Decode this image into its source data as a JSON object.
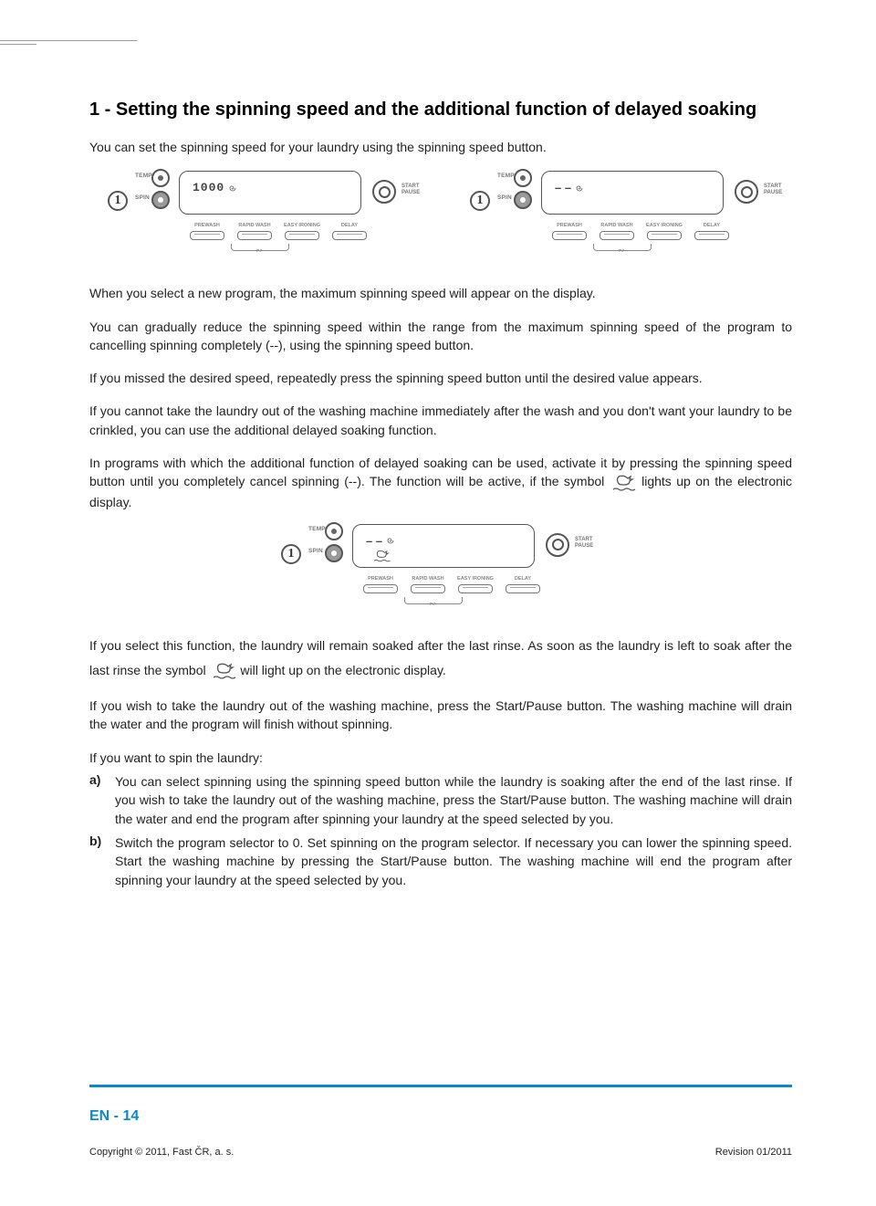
{
  "heading": "1 - Setting the spinning speed and the additional function of delayed soaking",
  "intro": "You can set the spinning speed for your laundry using the spinning speed button.",
  "p_select": "When you select a new program, the maximum spinning speed will appear on the display.",
  "p_reduce": "You can gradually reduce the spinning speed within the range from the maximum spinning speed of the program to cancelling spinning completely (--), using the spinning speed button.",
  "p_missed": "If you missed the desired speed, repeatedly press the spinning speed button until the desired value appears.",
  "p_crinkled": "If you cannot take the laundry out of the washing machine immediately after the wash and you don't want your laundry to be crinkled, you can use the additional delayed soaking function.",
  "p_activate_a": "In programs with which the additional function of delayed soaking can be used, activate it by pressing the spinning speed button until you completely cancel spinning (--). The function will be active, if the symbol ",
  "p_activate_b": " lights up on the electronic display.",
  "p_soaked_a": "If you select this function, the laundry will remain soaked after the last rinse. As soon as the laundry is left to soak after the last rinse the symbol ",
  "p_soaked_b": " will light up on the electronic display.",
  "p_drain": "If you wish to take the laundry out of the washing machine, press the Start/Pause button. The washing machine will drain the water and the program will finish without spinning.",
  "p_want_spin": "If you want to spin the laundry:",
  "list": {
    "a": {
      "marker": "a)",
      "text": "You can select spinning using the spinning speed button while the laundry is soaking after the end of the last rinse.  If you wish to take the laundry out of the washing machine, press the Start/Pause button. The washing machine will drain the water and end the program after spinning your laundry at the speed selected by you."
    },
    "b": {
      "marker": "b)",
      "text": "Switch the program selector to 0.  Set spinning on the program selector. If necessary you can lower the spinning speed. Start the washing machine by pressing the Start/Pause button. The washing machine will end the program after spinning your laundry at the speed selected by you."
    }
  },
  "panel": {
    "temp": "TEMP.",
    "spin": "SPIN",
    "start": "START",
    "pause": "PAUSE",
    "one": "1",
    "digits": "1000",
    "dashes": "– –",
    "buttons": [
      "PREWASH",
      "RAPID WASH",
      "EASY IRONING",
      "DELAY"
    ]
  },
  "footer": {
    "page": "EN - 14",
    "copyright": "Copyright © 2011, Fast ČR, a. s.",
    "revision_label": "Revision ",
    "revision_value": "01/2011"
  }
}
